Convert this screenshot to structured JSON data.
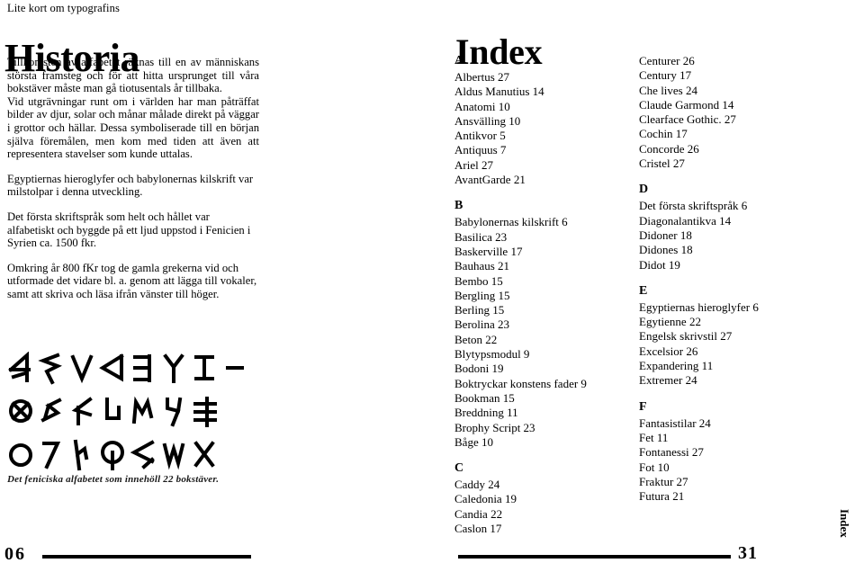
{
  "left_page": {
    "kicker": "Lite kort om typografins",
    "title": "Historia",
    "paragraphs": [
      "Tillkomsten av alfabetet räknas till en av människans största framsteg och för att hitta ursprunget till våra bokstäver måste man gå  tiotusentals år tillbaka.",
      "Vid utgrävningar runt om i världen har man påträffat bilder av djur, solar och månar målade direkt på väggar i grottor och hällar. Dessa symboliserade till en början själva föremålen, men kom med tiden att även att representera stavelser som kunde uttalas.",
      "Egyptiernas hieroglyfer och babylonernas kilskrift var milstolpar i denna utveckling.",
      "Det första skriftspråk som helt och hållet var alfabetiskt och byggde på ett ljud uppstod i Fenicien i Syrien ca. 1500 fkr.",
      "Omkring år 800 fKr tog de gamla grekerna vid och utformade det vidare bl. a. genom att lägga till vokaler, samt att skriva och läsa ifrån vänster till höger."
    ],
    "figure_caption": "Det feniciska alfabetet som innehöll 22 bokstäver.",
    "figure_alt": "Det feniciska alfabetet – 22 tecken i tre rader",
    "folio": "06"
  },
  "right_page": {
    "title": "Index",
    "column_one": [
      {
        "letter": "A",
        "entries": [
          "Albertus 27",
          "Aldus Manutius  14",
          "Anatomi 10",
          "Ansvälling 10",
          "Antikvor 5",
          "Antiquus  7",
          "Ariel 27",
          "AvantGarde 21"
        ]
      },
      {
        "letter": "B",
        "entries": [
          "Babylonernas kilskrift 6",
          "Basilica 23",
          "Baskerville 17",
          "Bauhaus  21",
          "Bembo 15",
          "Bergling 15",
          "Berling 15",
          "Berolina 23",
          "Beton 22",
          "Blytypsmodul 9",
          "Bodoni  19",
          "Boktryckar konstens fader  9",
          "Bookman 15",
          "Breddning  11",
          "Brophy Script 23",
          "Båge 10"
        ]
      },
      {
        "letter": "C",
        "entries": [
          "Caddy  24",
          "Caledonia 19",
          "Candia 22",
          "Caslon 17"
        ]
      }
    ],
    "column_two": [
      {
        "letter": "",
        "entries": [
          "Centurer 26",
          "Century  17",
          "Che lives 24",
          "Claude Garmond  14",
          "Clearface Gothic.  27",
          "Cochin 17",
          "Concorde 26",
          "Cristel 27"
        ]
      },
      {
        "letter": "D",
        "entries": [
          "Det första skriftspråk  6",
          "Diagonalantikva 14",
          "Didoner  18",
          "Didones  18",
          "Didot  19"
        ]
      },
      {
        "letter": "E",
        "entries": [
          "Egyptiernas hieroglyfer  6",
          "Egytienne  22",
          "Engelsk skrivstil 27",
          "Excelsior 26",
          "Expandering  11",
          "Extremer 24"
        ]
      },
      {
        "letter": "F",
        "entries": [
          "Fantasistilar  24",
          "Fet  11",
          "Fontanessi  27",
          "Fot 10",
          "Fraktur 27",
          "Futura 21"
        ]
      }
    ],
    "folio": "31",
    "side_tab": "Index"
  },
  "colors": {
    "ink": "#000000",
    "paper": "#ffffff"
  }
}
